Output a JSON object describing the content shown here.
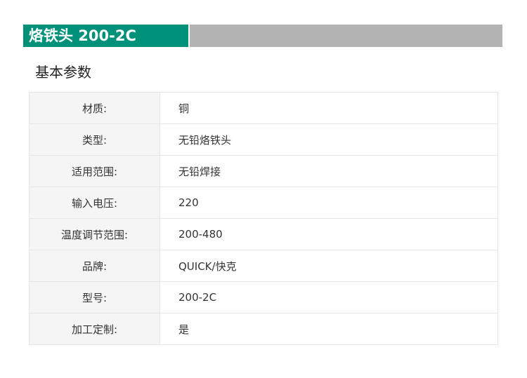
{
  "header": {
    "title": "烙铁头 200-2C"
  },
  "section": {
    "heading": "基本参数"
  },
  "params": [
    {
      "label": "材质:",
      "value": "铜"
    },
    {
      "label": "类型:",
      "value": "无铅烙铁头"
    },
    {
      "label": "适用范围:",
      "value": "无铅焊接"
    },
    {
      "label": "输入电压:",
      "value": "220"
    },
    {
      "label": "温度调节范围:",
      "value": "200-480"
    },
    {
      "label": "品牌:",
      "value": "QUICK/快克"
    },
    {
      "label": "型号:",
      "value": "200-2C"
    },
    {
      "label": "加工定制:",
      "value": "是"
    }
  ],
  "colors": {
    "title_bg": "#00917a",
    "title_fill": "#b3b3b3",
    "label_bg": "#f5f5f5",
    "border": "#e6e6e6"
  }
}
